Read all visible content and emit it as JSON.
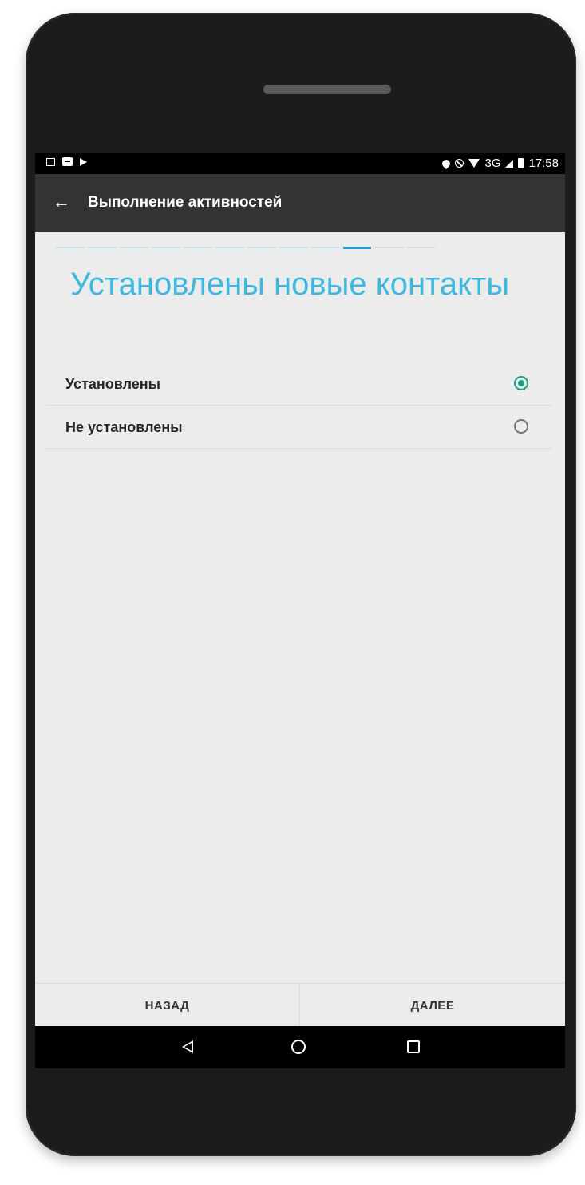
{
  "status_bar": {
    "left_icons": [
      "image-icon",
      "message-icon",
      "play-icon"
    ],
    "right_icons": [
      "location-icon",
      "no-disturb-icon",
      "wifi-icon",
      "signal-icon",
      "battery-icon"
    ],
    "network": "3G",
    "time": "17:58"
  },
  "app_bar": {
    "back_icon": "arrow-left-icon",
    "title": "Выполнение активностей"
  },
  "progress": {
    "total_steps": 12,
    "current_step": 10
  },
  "page": {
    "title": "Установлены новые контакты"
  },
  "options": [
    {
      "label": "Установлены",
      "checked": true
    },
    {
      "label": "Не установлены",
      "checked": false
    }
  ],
  "footer": {
    "back_label": "НАЗАД",
    "next_label": "ДАЛЕЕ"
  },
  "nav_bar": {
    "icons": [
      "nav-back-icon",
      "nav-home-icon",
      "nav-recent-icon"
    ]
  },
  "colors": {
    "accent": "#3fb8de",
    "radio_checked": "#1f9f88",
    "app_bar": "#333333"
  }
}
